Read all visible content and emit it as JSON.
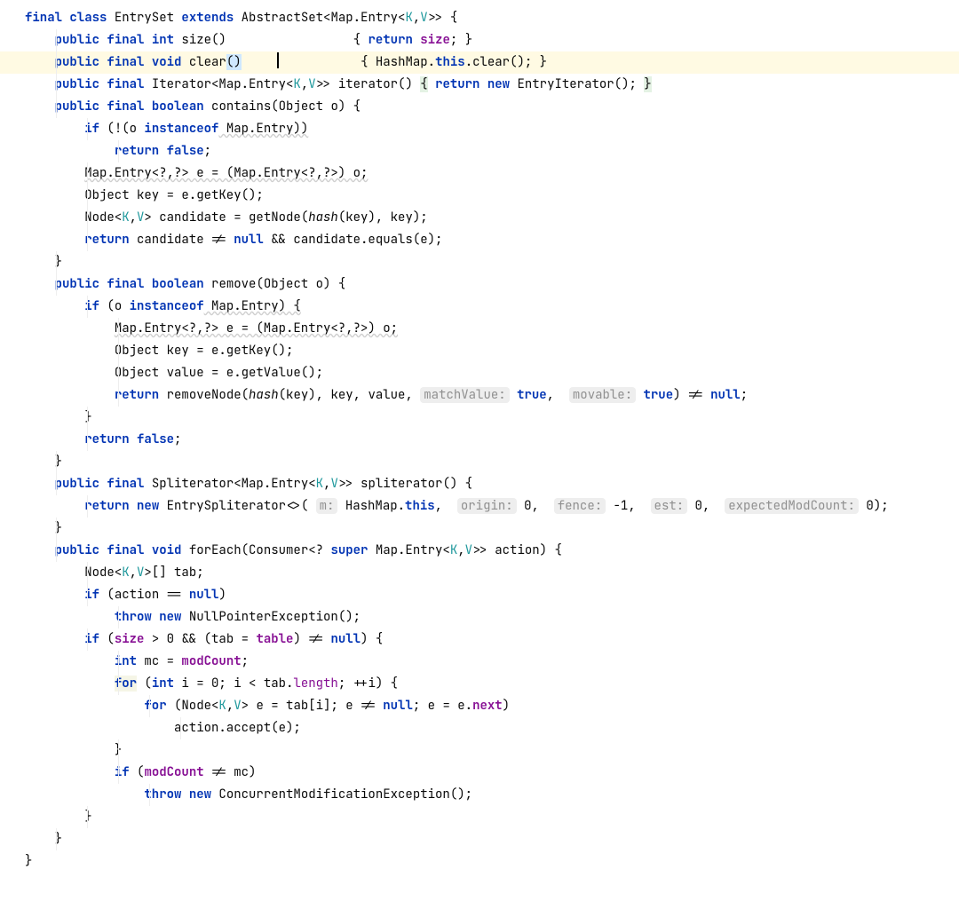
{
  "code": {
    "class_decl": {
      "kw_final": "final",
      "kw_class": "class",
      "name": "EntrySet",
      "kw_extends": "extends",
      "base": "AbstractSet",
      "lt": "<",
      "map": "Map",
      "entry": ".Entry<",
      "K": "K",
      "comma": ",",
      "V": "V",
      "gtgt": ">>",
      "brace": " {"
    },
    "size": {
      "kw_public": "public",
      "kw_final": "final",
      "kw_int": "int",
      "name": " size()",
      "pad": "                 ",
      "body_open": "{ ",
      "kw_return": "return",
      "sp": " ",
      "fld": "size",
      "body_close": "; }"
    },
    "clear": {
      "kw_public": "public",
      "kw_final": "final",
      "kw_void": "void",
      "name": " clear",
      "paren": "()",
      "body_open": "{ ",
      "txt1": "HashMap.",
      "kw_this": "this",
      "txt2": ".clear(); }"
    },
    "iterator": {
      "kw_public": "public",
      "kw_final": "final",
      "txt1": " Iterator<Map.Entry<",
      "K": "K",
      "comma": ",",
      "V": "V",
      "txt2": ">> iterator() ",
      "ob": "{",
      "sp": " ",
      "kw_return": "return",
      "kw_new": "new",
      "txt3": " EntryIterator(); ",
      "cb": "}"
    },
    "contains": {
      "sig": {
        "kw_public": "public",
        "kw_final": "final",
        "kw_boolean": "boolean",
        "name": " contains(Object o) {"
      },
      "l1": {
        "kw_if": "if",
        "txt": " (!(o ",
        "kw_inst": "instanceof",
        "txt2": " Map.Entry))"
      },
      "l2": {
        "kw_return": "return",
        "kw_false": "false",
        "semi": ";"
      },
      "l3": "Map.Entry<?,?> e = (Map.Entry<?,?>) o;",
      "l4": "Object key = e.getKey();",
      "l5": {
        "txt1": "Node<",
        "K": "K",
        "comma": ",",
        "V": "V",
        "txt2": "> candidate = getNode(",
        "hash": "hash",
        "txt3": "(key), key);"
      },
      "l6": {
        "kw_return": "return",
        "txt": " candidate != ",
        "kw_null": "null",
        "txt2": " && candidate.equals(e);"
      },
      "close": "}"
    },
    "remove": {
      "sig": {
        "kw_public": "public",
        "kw_final": "final",
        "kw_boolean": "boolean",
        "name": " remove(Object o) {"
      },
      "l1": {
        "kw_if": "if",
        "txt": " (o ",
        "kw_inst": "instanceof",
        "txt2": " Map.Entry) {"
      },
      "l2": "Map.Entry<?,?> e = (Map.Entry<?,?>) o;",
      "l3": "Object key = e.getKey();",
      "l4": "Object value = e.getValue();",
      "l5": {
        "kw_return": "return",
        "txt": " removeNode(",
        "hash": "hash",
        "txt2": "(key), key, value, ",
        "h1": "matchValue:",
        "kw_true1": "true",
        "comma": ", ",
        "h2": "movable:",
        "kw_true2": "true",
        "txt3": ") != ",
        "kw_null": "null",
        "semi": ";"
      },
      "close_inner": "}",
      "ret_false": {
        "kw_return": "return",
        "kw_false": "false",
        "semi": ";"
      },
      "close": "}"
    },
    "spliterator": {
      "sig": {
        "kw_public": "public",
        "kw_final": "final",
        "txt": " Spliterator<Map.Entry<",
        "K": "K",
        "comma": ",",
        "V": "V",
        "txt2": ">> spliterator() {"
      },
      "body": {
        "kw_return": "return",
        "kw_new": "new",
        "txt": " EntrySpliterator<>( ",
        "h1": "m:",
        "txt1": " HashMap.",
        "kw_this": "this",
        "txt2": ", ",
        "h2": "origin:",
        "v2": " 0",
        "c2": ", ",
        "h3": "fence:",
        "v3": " -1",
        "c3": ", ",
        "h4": "est:",
        "v4": " 0",
        "c4": ", ",
        "h5": "expectedModCount:",
        "v5": " 0",
        "end": ");"
      },
      "close": "}"
    },
    "foreach": {
      "sig": {
        "kw_public": "public",
        "kw_final": "final",
        "kw_void": "void",
        "txt": " forEach(Consumer<? ",
        "kw_super": "super",
        "txt2": " Map.Entry<",
        "K": "K",
        "comma": ",",
        "V": "V",
        "txt3": ">> action) {"
      },
      "l1": {
        "txt1": "Node<",
        "K": "K",
        "comma": ",",
        "V": "V",
        "txt2": ">[] tab;"
      },
      "l2": {
        "kw_if": "if",
        "txt": " (action == ",
        "kw_null": "null",
        "close": ")"
      },
      "l3": {
        "kw_throw": "throw",
        "kw_new": "new",
        "txt": " NullPointerException();"
      },
      "l4": {
        "kw_if": "if",
        "txt": " (",
        "fsize": "size",
        "txt1": " > 0 && (tab = ",
        "ftable": "table",
        "txt2": ") != ",
        "kw_null": "null",
        "close": ") {"
      },
      "l5": {
        "kw_int": "int",
        "txt": " mc = ",
        "fmod": "modCount",
        "semi": ";"
      },
      "l6": {
        "kw_for": "for",
        "txt": " (",
        "kw_int": "int",
        "txt2": " i = 0; i < tab.",
        "flen": "length",
        "txt3": "; ++i) {"
      },
      "l7": {
        "kw_for": "for",
        "txt": " (Node<",
        "K": "K",
        "comma": ",",
        "V": "V",
        "txt2": "> e = tab[i]; e != ",
        "kw_null": "null",
        "txt3": "; e = e.",
        "fnext": "next",
        "close": ")"
      },
      "l8": "action.accept(e);",
      "l9": "}",
      "l10": {
        "kw_if": "if",
        "txt": " (",
        "fmod": "modCount",
        "txt2": " != mc)"
      },
      "l11": {
        "kw_throw": "throw",
        "kw_new": "new",
        "txt": " ConcurrentModificationException();"
      },
      "close2": "}",
      "close1": "}"
    },
    "class_close": "}"
  }
}
